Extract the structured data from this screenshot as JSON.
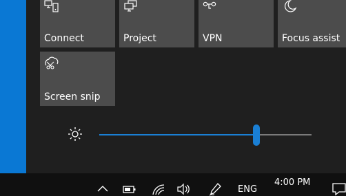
{
  "quick_actions": [
    {
      "label": "Connect",
      "icon": "connect-icon"
    },
    {
      "label": "Project",
      "icon": "project-icon"
    },
    {
      "label": "VPN",
      "icon": "vpn-icon"
    },
    {
      "label": "Focus assist",
      "icon": "moon-icon"
    },
    {
      "label": "Screen snip",
      "icon": "screen-snip-icon"
    }
  ],
  "brightness": {
    "level": 0.74,
    "icon": "sun-icon"
  },
  "colors": {
    "accent": "#0a78d4",
    "tile_bg": "#4c4c4c",
    "panel_bg": "#1f1f1f"
  },
  "taskbar": {
    "language": "ENG",
    "time": "4:00 PM",
    "icons": [
      "chevron-up-icon",
      "battery-icon",
      "wifi-icon",
      "speaker-icon",
      "pen-icon",
      "notification-icon"
    ]
  }
}
